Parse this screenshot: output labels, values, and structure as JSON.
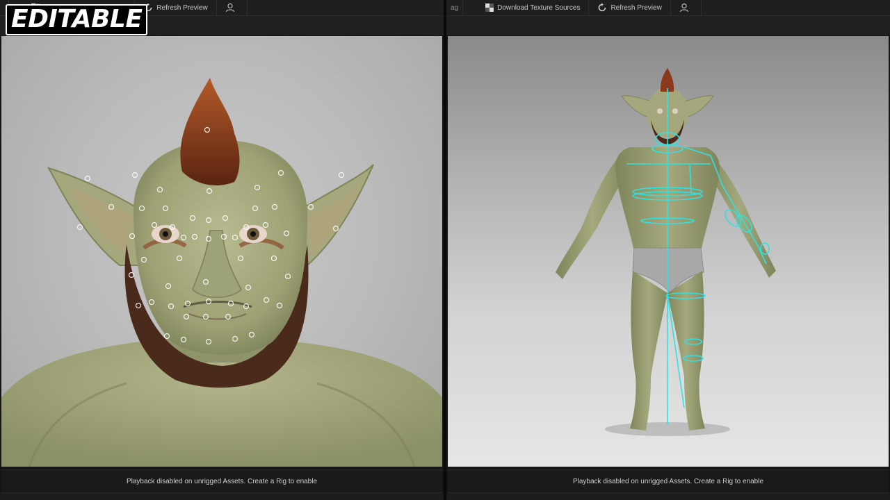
{
  "badge": "EDITABLE",
  "toolbar": {
    "left_stub": "",
    "right_stub": "ag",
    "download_label": "Download Texture Sources",
    "refresh_label": "Refresh Preview",
    "icons": [
      "checker-icon",
      "refresh-icon",
      "user-icon"
    ]
  },
  "status": {
    "left": "Playback disabled on unrigged Assets. Create a Rig to enable",
    "right": "Playback disabled on unrigged Assets. Create a Rig to enable"
  },
  "colors": {
    "skin": "#a9ad82",
    "hair": "#8a3a1a",
    "rig": "#2fe2e2",
    "ui_dark": "#1e1e1e"
  }
}
